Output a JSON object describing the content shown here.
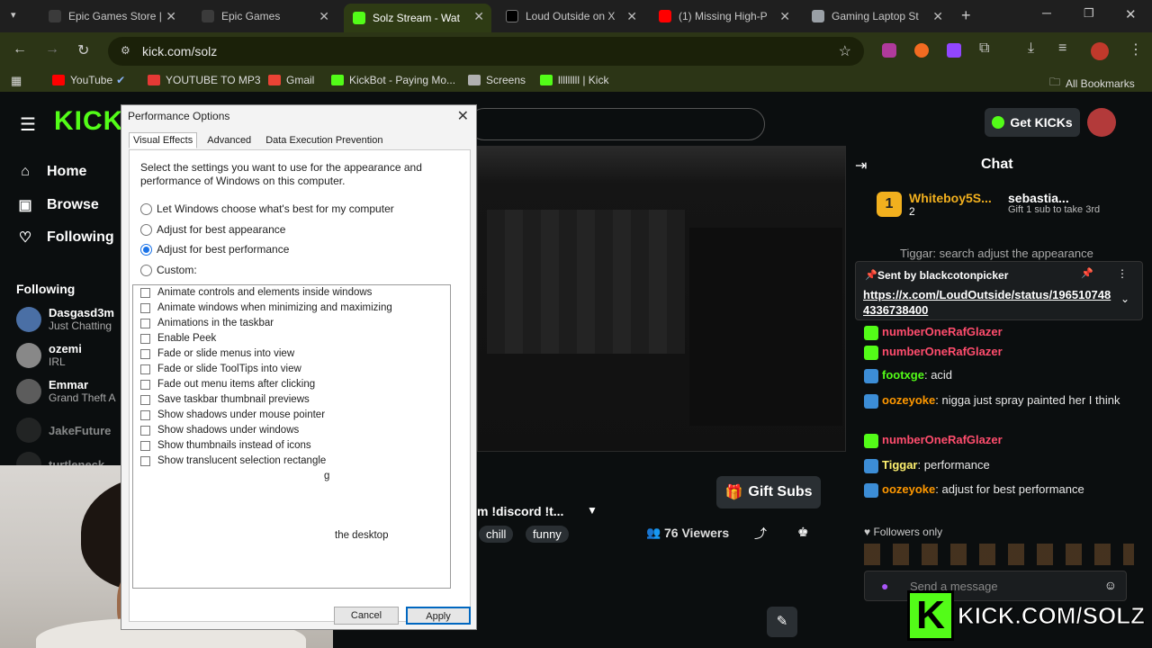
{
  "browser": {
    "tabs": [
      {
        "title": "Epic Games Store |",
        "fav": "#3b3b3b"
      },
      {
        "title": "Epic Games",
        "fav": "#3b3b3b"
      },
      {
        "title": "Solz Stream - Wat",
        "fav": "#53fc18"
      },
      {
        "title": "Loud Outside on X",
        "fav": "#000000"
      },
      {
        "title": "(1) Missing High-P",
        "fav": "#ff0000"
      },
      {
        "title": "Gaming Laptop St",
        "fav": "#9aa0a6"
      }
    ],
    "url": "kick.com/solz",
    "bookmarks": [
      {
        "label": "YouTube",
        "color": "#ff0000"
      },
      {
        "label": "YOUTUBE TO MP3",
        "color": "#e53935"
      },
      {
        "label": "Gmail",
        "color": "#ea4335"
      },
      {
        "label": "KickBot - Paying Mo...",
        "color": "#53fc18"
      },
      {
        "label": "Screens",
        "color": "#b0b0b0"
      },
      {
        "label": "lllllllll | Kick",
        "color": "#53fc18"
      }
    ],
    "all_bookmarks": "All Bookmarks"
  },
  "kick": {
    "logo": "KICK",
    "get_kicks": "Get KICKs",
    "nav": [
      {
        "label": "Home",
        "icon": "home-icon"
      },
      {
        "label": "Browse",
        "icon": "browse-icon"
      },
      {
        "label": "Following",
        "icon": "heart-icon"
      }
    ],
    "following_heading": "Following",
    "following": [
      {
        "name": "Dasgasd3m",
        "sub": "Just Chatting",
        "color": "#4a6fa5"
      },
      {
        "name": "ozemi",
        "sub": "IRL",
        "color": "#888888"
      },
      {
        "name": "Emmar",
        "sub": "Grand Theft A",
        "color": "#5c5c5c"
      },
      {
        "name": "JakeFuture",
        "sub": "",
        "color": "#3a3a3a"
      },
      {
        "name": "turtleneck",
        "sub": "",
        "color": "#3a3a3a"
      }
    ],
    "chat_title": "Chat",
    "top_gifters": [
      {
        "name": "Whiteboy5S...",
        "count": "2"
      },
      {
        "name": "sebastia...",
        "count": "1",
        "note": "Gift 1 sub to take 3rd"
      }
    ],
    "pinned": {
      "behind": "Tiggar: search adjust the appearance",
      "sent_by": "Sent by blackcotonpicker",
      "link": "https://x.com/LoudOutside/status/1965107484336738400"
    },
    "messages": [
      {
        "user": "numberOneRafGlazer",
        "text": "",
        "color": "#ff4d6d"
      },
      {
        "user": "numberOneRafGlazer",
        "text": "",
        "color": "#ff4d6d"
      },
      {
        "user": "footxge",
        "text": "acid",
        "color": "#53fc18"
      },
      {
        "user": "oozeyoke",
        "text": "nigga just spray painted her I think",
        "color": "#ff9800"
      },
      {
        "user": "numberOneRafGlazer",
        "text": "",
        "color": "#ff4d6d"
      },
      {
        "user": "Tiggar",
        "text": "performance",
        "color": "#fff170"
      },
      {
        "user": "oozeyoke",
        "text": "adjust for best performance",
        "color": "#ff9800"
      }
    ],
    "followers_only": "Followers only",
    "send_placeholder": "Send a message",
    "stream_title": "m !discord !t...",
    "tags": [
      "chill",
      "funny"
    ],
    "viewers": "76 Viewers",
    "gift_subs": "Gift Subs",
    "overlay_text": "KICK.COM/SOLZ"
  },
  "dialog": {
    "title": "Performance Options",
    "tabs": [
      "Visual Effects",
      "Advanced",
      "Data Execution Prevention"
    ],
    "description": "Select the settings you want to use for the appearance and performance of Windows on this computer.",
    "options": [
      {
        "label": "Let Windows choose what's best for my computer",
        "checked": false
      },
      {
        "label": "Adjust for best appearance",
        "checked": false
      },
      {
        "label": "Adjust for best performance",
        "checked": true
      },
      {
        "label": "Custom:",
        "checked": false
      }
    ],
    "effects": [
      "Animate controls and elements inside windows",
      "Animate windows when minimizing and maximizing",
      "Animations in the taskbar",
      "Enable Peek",
      "Fade or slide menus into view",
      "Fade or slide ToolTips into view",
      "Fade out menu items after clicking",
      "Save taskbar thumbnail previews",
      "Show shadows under mouse pointer",
      "Show shadows under windows",
      "Show thumbnails instead of icons",
      "Show translucent selection rectangle"
    ],
    "partial_effect_tail": "g",
    "partial_effect_desktop": "the desktop",
    "cancel": "Cancel",
    "apply": "Apply"
  }
}
